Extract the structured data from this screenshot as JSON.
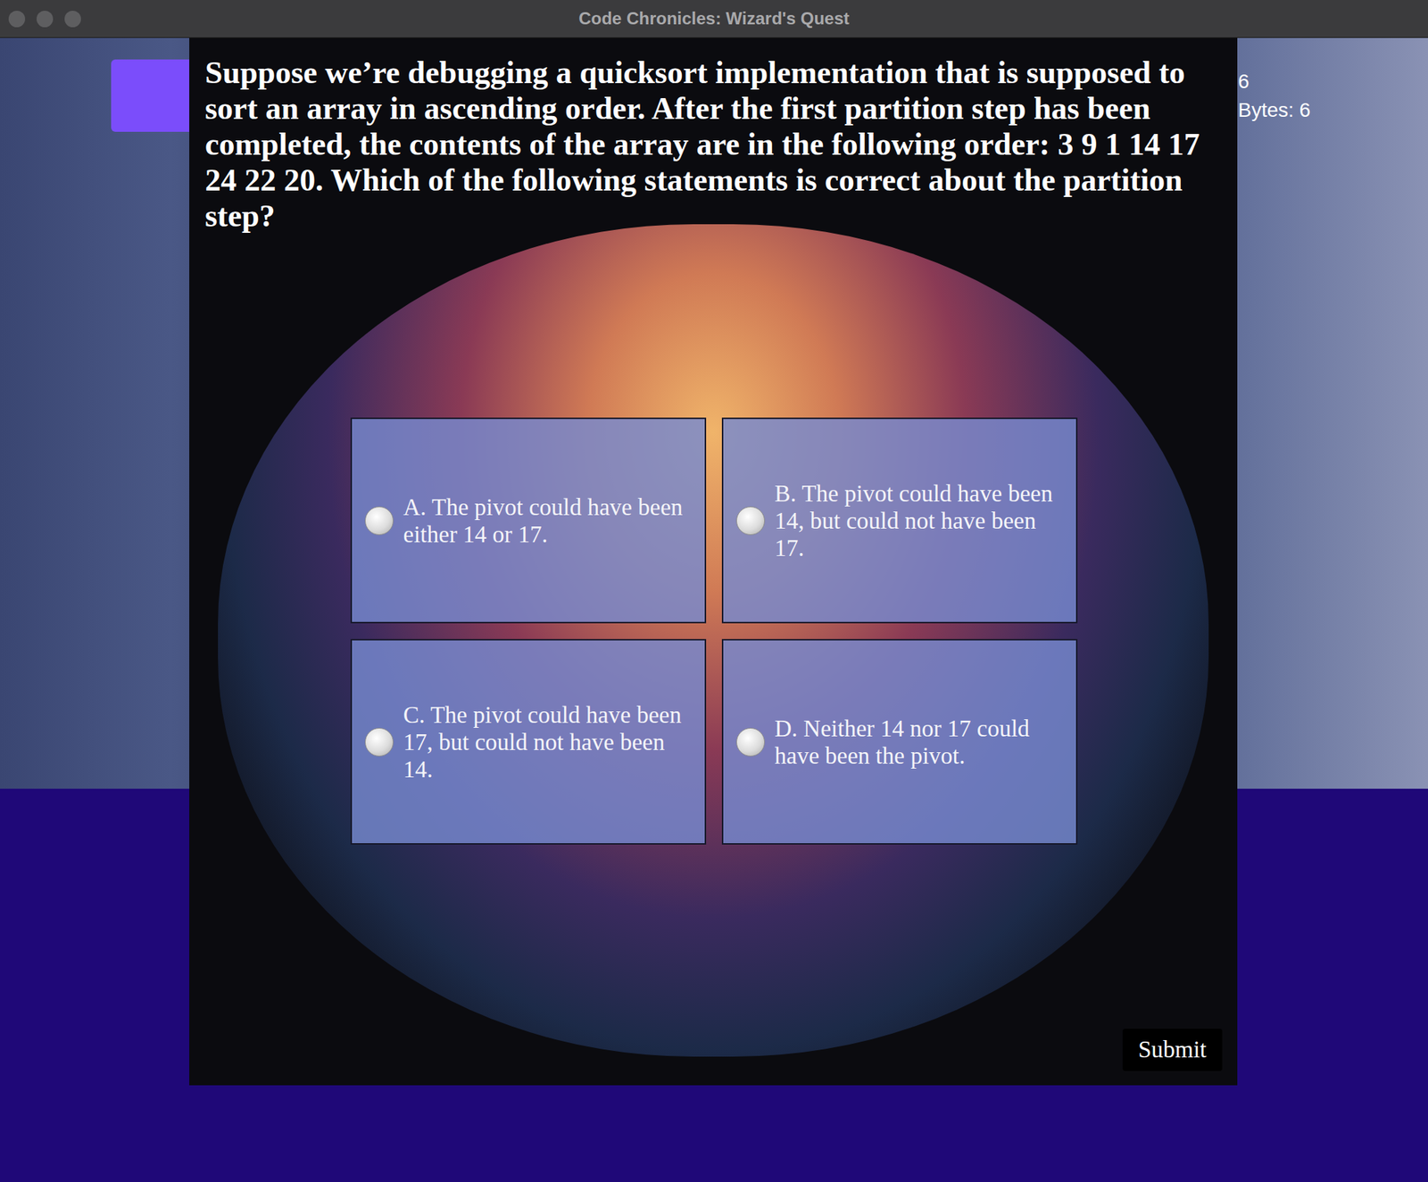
{
  "window": {
    "title": "Code Chronicles: Wizard's Quest"
  },
  "hud": {
    "stats": [
      "6",
      "Bytes: 6"
    ]
  },
  "question": {
    "text": "Suppose we’re debugging a quicksort implementation that is supposed to sort an array in ascending order. After the first partition step has been completed, the contents of the array are in the following order: 3 9 1 14 17 24 22 20. Which of the following statements is correct about the partition step?"
  },
  "options": [
    {
      "label": "A. The pivot could have been either 14 or 17.",
      "selected": false
    },
    {
      "label": "B. The pivot could have been 14, but could not have been 17.",
      "selected": false
    },
    {
      "label": "C. The pivot could have been 17, but could not have been 14.",
      "selected": false
    },
    {
      "label": "D. Neither 14 nor 17 could have been the pivot.",
      "selected": false
    }
  ],
  "buttons": [
    "Submit"
  ]
}
